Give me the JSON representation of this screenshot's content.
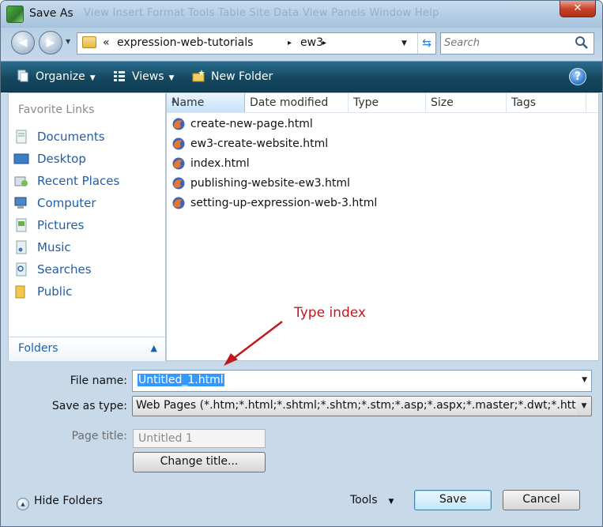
{
  "window": {
    "title": "Save As",
    "ghost_menu": "View    Insert    Format    Tools    Table    Site    Data View    Panels    Window    Help",
    "close_label": "✕"
  },
  "address": {
    "overflow": "«",
    "crumbs": [
      "expression-web-tutorials",
      "ew3"
    ],
    "separator": "▸"
  },
  "search": {
    "placeholder": "Search"
  },
  "toolbar": {
    "organize": "Organize",
    "views": "Views",
    "new_folder": "New Folder",
    "help": "?"
  },
  "favorites": {
    "header": "Favorite Links",
    "items": [
      "Documents",
      "Desktop",
      "Recent Places",
      "Computer",
      "Pictures",
      "Music",
      "Searches",
      "Public"
    ],
    "folders_label": "Folders"
  },
  "columns": [
    "Name",
    "Date modified",
    "Type",
    "Size",
    "Tags"
  ],
  "files": [
    "create-new-page.html",
    "ew3-create-website.html",
    "index.html",
    "publishing-website-ew3.html",
    "setting-up-expression-web-3.html"
  ],
  "annotation": "Type index",
  "form": {
    "file_name_label": "File name:",
    "file_name_value": "Untitled_1.html",
    "save_as_type_label": "Save as type:",
    "save_as_type_value": "Web Pages (*.htm;*.html;*.shtml;*.shtm;*.stm;*.asp;*.aspx;*.master;*.dwt;*.htt;*.inc;*.hta)",
    "page_title_label": "Page title:",
    "page_title_value": "Untitled 1",
    "change_title": "Change title..."
  },
  "footer": {
    "hide_folders": "Hide Folders",
    "tools": "Tools",
    "save": "Save",
    "cancel": "Cancel"
  },
  "colors": {
    "toolbar": "#14485f",
    "link": "#1f5fa8",
    "annotation": "#c0181e",
    "selection": "#3399ff"
  }
}
